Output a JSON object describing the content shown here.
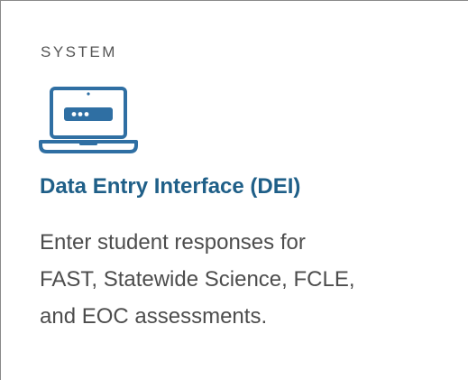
{
  "card": {
    "category": "SYSTEM",
    "icon": "laptop-login-icon",
    "title": "Data Entry Interface (DEI)",
    "description_lines": [
      "Enter student responses for",
      "FAST, Statewide Science, FCLE,",
      "and EOC assessments."
    ]
  },
  "colors": {
    "title": "#1f5f88",
    "icon": "#2f6fa3",
    "category_text": "#555555",
    "body_text": "#4d4d4d",
    "card_border": "#8a8a8a"
  }
}
